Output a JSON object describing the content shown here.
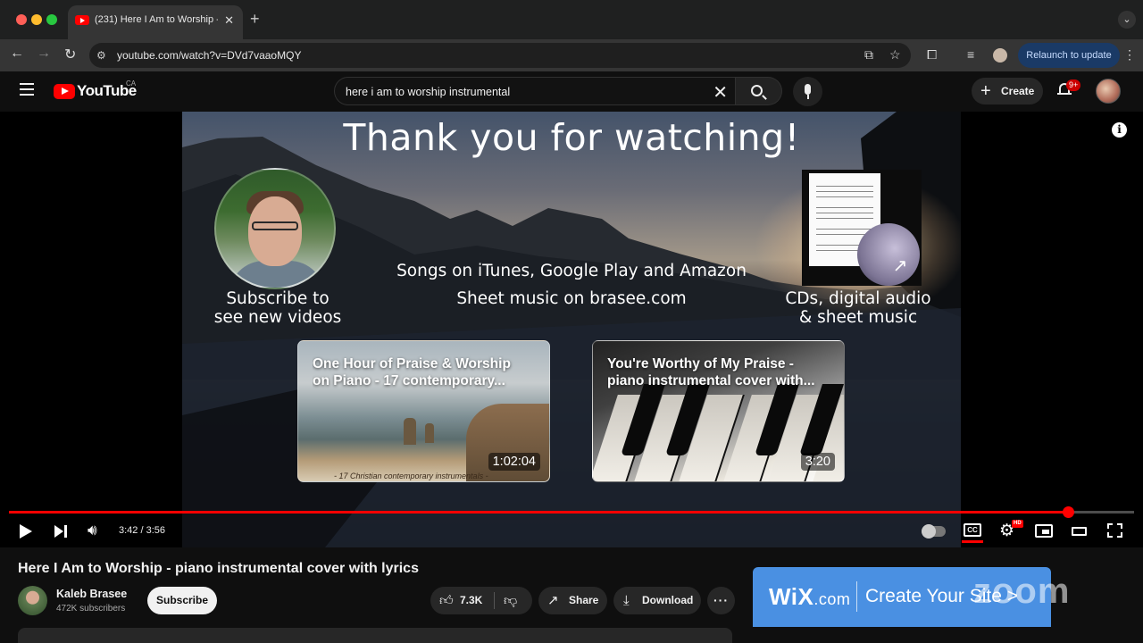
{
  "browser": {
    "tab_title": "(231) Here I Am to Worship -",
    "new_tab": "+",
    "url": "youtube.com/watch?v=DVd7vaaoMQY",
    "relaunch_label": "Relaunch to update"
  },
  "youtube": {
    "logo_text": "YouTube",
    "country": "CA",
    "search_value": "here i am to worship instrumental",
    "create_label": "Create",
    "notifications_badge": "9+"
  },
  "endscreen": {
    "title": "Thank you for watching!",
    "subscribe_line1": "Subscribe to",
    "subscribe_line2": "see new videos",
    "songs_line": "Songs on iTunes, Google Play and Amazon",
    "sheet_line": "Sheet music on brasee.com",
    "merch_line1": "CDs, digital audio",
    "merch_line2": "& sheet music",
    "cards": [
      {
        "title_line1": "One Hour of Praise & Worship",
        "title_line2": "on Piano - 17 contemporary...",
        "duration": "1:02:04",
        "subtitle": "- 17 Christian contemporary instrumentals -"
      },
      {
        "title_line1": "You're Worthy of My Praise -",
        "title_line2": "piano instrumental cover with...",
        "duration": "3:20"
      }
    ]
  },
  "player": {
    "time": "3:42 / 3:56",
    "progress": 0.941,
    "hd_badge": "HD",
    "cc_label": "CC"
  },
  "video": {
    "title": "Here I Am to Worship - piano instrumental cover with lyrics",
    "channel": "Kaleb Brasee",
    "subscribers": "472K subscribers",
    "subscribe_label": "Subscribe",
    "likes": "7.3K",
    "share_label": "Share",
    "download_label": "Download"
  },
  "ad": {
    "brand": "WiX",
    "brand_suffix": ".com",
    "cta": "Create Your Site >"
  },
  "watermark": "zoom",
  "colors": {
    "accent_red": "#ff0000",
    "ad_blue": "#4a90e2",
    "relaunch_bg": "#1a3a66"
  }
}
